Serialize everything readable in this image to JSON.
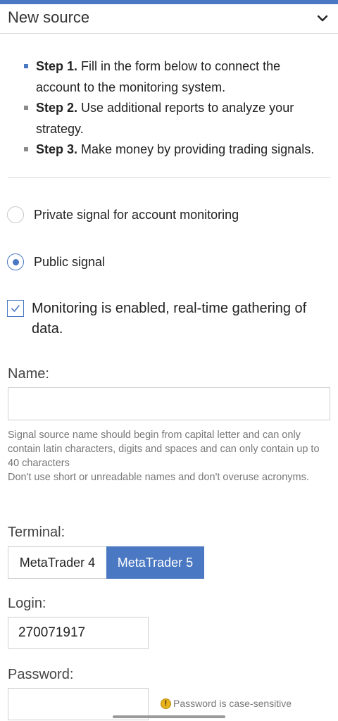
{
  "header": {
    "title": "New source"
  },
  "steps": [
    {
      "label": "Step 1.",
      "text": " Fill in the form below to connect the account to the monitoring system."
    },
    {
      "label": "Step 2.",
      "text": " Use additional reports to analyze your strategy."
    },
    {
      "label": "Step 3.",
      "text": " Make money by providing trading signals."
    }
  ],
  "signal_type": {
    "options": [
      {
        "label": "Private signal for account monitoring",
        "selected": false
      },
      {
        "label": "Public signal",
        "selected": true
      }
    ]
  },
  "monitoring": {
    "label": "Monitoring is enabled, real-time gathering of data.",
    "checked": true
  },
  "name": {
    "label": "Name:",
    "value": "",
    "hint_line1": "Signal source name should begin from capital letter and can only contain latin characters, digits and spaces and can only contain up to 40 characters",
    "hint_line2": "Don't use short or unreadable names and don't overuse acronyms."
  },
  "terminal": {
    "label": "Terminal:",
    "options": [
      "MetaTrader 4",
      "MetaTrader 5"
    ],
    "selected": "MetaTrader 5"
  },
  "login": {
    "label": "Login:",
    "value": "270071917"
  },
  "password": {
    "label": "Password:",
    "value": "",
    "hint": "Password is case-sensitive"
  },
  "colors": {
    "accent": "#4a78c2",
    "warning": "#e6b21e"
  },
  "icons": {
    "header_toggle": "chevron-down-icon",
    "password_hint": "warning-icon",
    "monitoring_check": "checkmark-icon"
  }
}
